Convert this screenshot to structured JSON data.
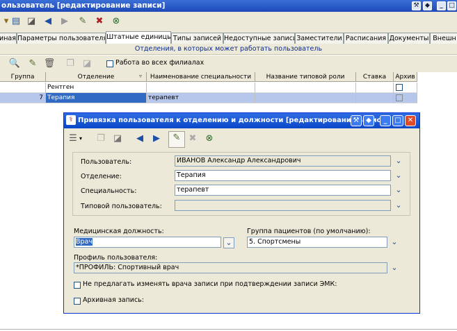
{
  "window": {
    "title": "ользователь [редактирование записи]"
  },
  "tabs": [
    {
      "label": "иная"
    },
    {
      "label": "Параметры пользователя"
    },
    {
      "label": "Штатные единицы"
    },
    {
      "label": "Типы записей"
    },
    {
      "label": "Недоступные записи"
    },
    {
      "label": "Заместители"
    },
    {
      "label": "Расписания"
    },
    {
      "label": "Документы"
    },
    {
      "label": "Внешн"
    }
  ],
  "section": {
    "title": "Отделения, в которых может работать пользователь"
  },
  "toolbar": {
    "all_branches_label": "Работа во всех филиалах"
  },
  "grid": {
    "columns": [
      "Группа",
      "Отделение",
      "Наименование специальности",
      "Название типовой роли",
      "Ставка",
      "Архив"
    ],
    "rows": [
      {
        "group": "",
        "department": "Рентген",
        "specialty": "",
        "role": "",
        "rate": ""
      },
      {
        "group": "7",
        "department": "Терапия",
        "specialty": "терапевт",
        "role": "",
        "rate": ""
      }
    ]
  },
  "dialog": {
    "title": "Привязка пользователя к отделению и должности [редактирование записи]",
    "user_label": "Пользователь:",
    "user_value": "ИВАНОВ Александр Александрович",
    "department_label": "Отделение:",
    "department_value": "Терапия",
    "specialty_label": "Специальность:",
    "specialty_value": "терапевт",
    "typical_user_label": "Типовой пользователь:",
    "typical_user_value": "",
    "position_label": "Медицинская должность:",
    "position_value": "Врач",
    "patient_group_label": "Группа пациентов (по умолчанию):",
    "patient_group_value": "5. Спортсмены",
    "profile_label": "Профиль пользователя:",
    "profile_value": "*ПРОФИЛЬ: Спортивный врач",
    "no_change_doctor_label": "Не предлагать изменять врача записи при подтверждении записи ЭМК:",
    "archive_label": "Архивная запись:"
  },
  "colors": {
    "title_blue": "#1d49b8",
    "selection": "#316ac5",
    "panel": "#ece9d8"
  }
}
